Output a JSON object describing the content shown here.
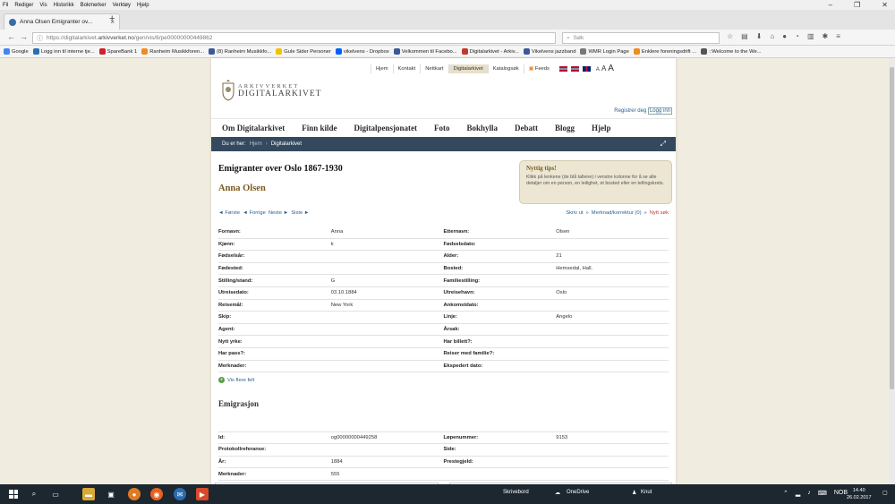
{
  "menubar": [
    "Fil",
    "Rediger",
    "Vis",
    "Historikk",
    "Bokmerker",
    "Verktøy",
    "Hjelp"
  ],
  "tab": {
    "title": "Anna Olsen Emigranter ov..."
  },
  "url": {
    "prefix": "https://digitalarkivet.",
    "domain": "arkivverket.no",
    "path": "/gen/vis/6/pe00000000449862"
  },
  "search": {
    "placeholder": "Søk"
  },
  "bookmarks": [
    {
      "label": "Google",
      "color": "#4285f4"
    },
    {
      "label": "Logg inn til interne tje...",
      "color": "#2a6fb5"
    },
    {
      "label": "SpareBank 1",
      "color": "#d11f2b"
    },
    {
      "label": "Ranheim Musikkforen...",
      "color": "#f08a24"
    },
    {
      "label": "(8) Ranheim Musikkfo...",
      "color": "#3b5998"
    },
    {
      "label": "Gule Sider Personer",
      "color": "#f2c200"
    },
    {
      "label": "vikelvens - Dropbox",
      "color": "#0061ff"
    },
    {
      "label": "Velkommen til Facebo...",
      "color": "#3b5998"
    },
    {
      "label": "Digitalarkivet - Arkiv...",
      "color": "#c0392b"
    },
    {
      "label": "Vikelvens jazzband",
      "color": "#3b5998"
    },
    {
      "label": "WMR Login Page",
      "color": "#777777"
    },
    {
      "label": "Enklere foreningsdrift ...",
      "color": "#f08a24"
    },
    {
      "label": "::Welcome to the We...",
      "color": "#555555"
    }
  ],
  "site": {
    "topnav": [
      "Hjem",
      "Kontakt",
      "Nettkart",
      "Digitalarkivet",
      "Katalogsøk",
      "Feeds"
    ],
    "sizes": [
      "A",
      "A",
      "A"
    ],
    "logo_line1": "ARKIVVERKET",
    "logo_line2": "DIGITALARKIVET",
    "register": "Registrer deg",
    "login": "Logg inn",
    "mainmenu": [
      "Om Digitalarkivet",
      "Finn kilde",
      "Digitalpensjonatet",
      "Foto",
      "Bokhylla",
      "Debatt",
      "Blogg",
      "Hjelp"
    ],
    "crumb_label": "Du er her:",
    "crumb_home": "Hjem",
    "crumb_current": "Digitalarkivet",
    "heading": "Emigranter over Oslo 1867-1930",
    "person": "Anna Olsen",
    "tips_title": "Nyttig tips!",
    "tips_body": "Klikk på lenkene (de blå tallene) i venstre kolonne for å se alle detaljer om en person, en leilighet, et bosted eller en tellingskrets.",
    "pager": [
      "◄ Første",
      "◄ Forrige",
      "Neste ►",
      "Siste ►"
    ],
    "actions": {
      "print": "Skriv ut",
      "note": "Merknad/korrektur (0)",
      "new": "Nytt søk"
    },
    "fields": [
      [
        "Fornavn:",
        "Anna",
        "Etternavn:",
        "Olsen"
      ],
      [
        "Kjønn:",
        "k",
        "Fødselsdato:",
        ""
      ],
      [
        "Fødselsår:",
        "",
        "Alder:",
        "21"
      ],
      [
        "Fødested:",
        "",
        "Bosted:",
        "Hemsedal, Hall."
      ],
      [
        "Stilling/stand:",
        "G",
        "Familiestilling:",
        ""
      ],
      [
        "Utreisedato:",
        "03.10.1884",
        "Utreisehavn:",
        "Oslo"
      ],
      [
        "Reisemål:",
        "New York",
        "Ankomstdato:",
        ""
      ],
      [
        "Skip:",
        "",
        "Linje:",
        "Angelo"
      ],
      [
        "Agent:",
        "",
        "Årsak:",
        ""
      ],
      [
        "Nytt yrke:",
        "",
        "Har billett?:",
        ""
      ],
      [
        "Har pass?:",
        "",
        "Reiser med familie?:",
        ""
      ],
      [
        "Merknader:",
        "",
        "Ekspedert dato:",
        ""
      ]
    ],
    "more_fields": "Vis flere felt",
    "section2": "Emigrasjon",
    "fields2": [
      [
        "",
        "",
        "",
        ""
      ],
      [
        "Id:",
        "og00000000449258",
        "Løpenummer:",
        "9153"
      ],
      [
        "Protokollreferanse:",
        "",
        "Side:",
        ""
      ],
      [
        "År:",
        "1884",
        "Prestegjeld:",
        ""
      ],
      [
        "Merknader:",
        "555",
        "",
        ""
      ]
    ]
  },
  "taskbar": {
    "desktop": "Skrivebord",
    "onedrive": "OneDrive",
    "knut": "Knut",
    "lang": "NOB",
    "time": "14.40",
    "date": "26.02.2017"
  }
}
